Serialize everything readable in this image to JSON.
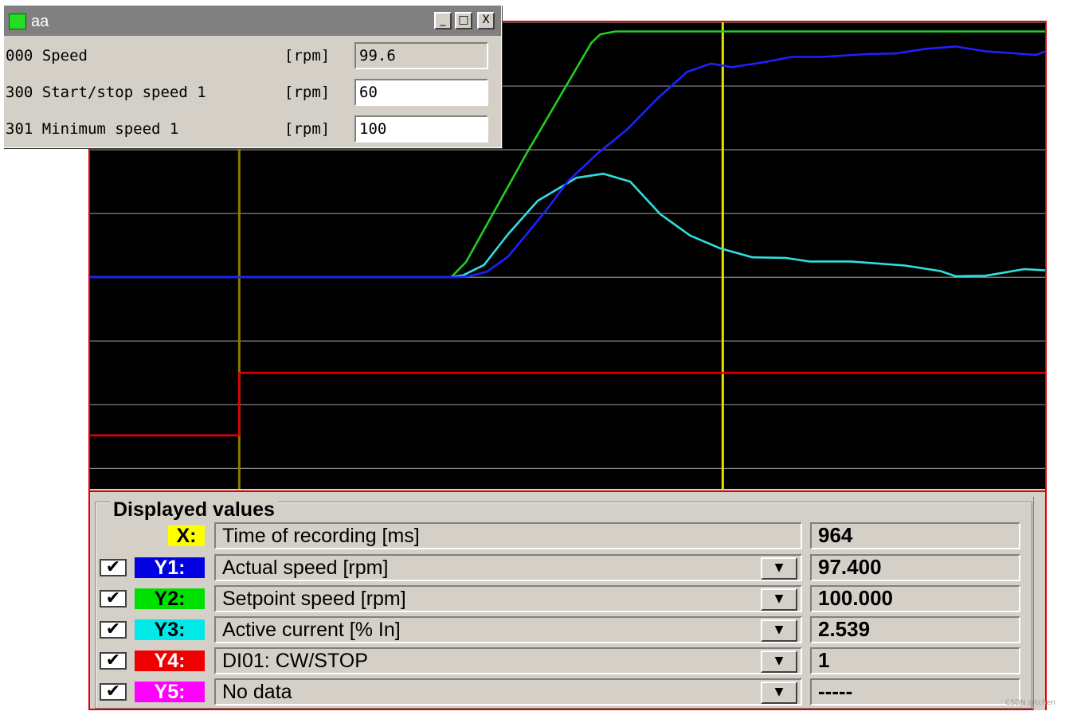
{
  "param_window": {
    "title": "aa",
    "buttons": [
      "_",
      "□",
      "X"
    ],
    "params": [
      {
        "name": "000 Speed",
        "unit": "[rpm]",
        "value": "99.6",
        "editable": false
      },
      {
        "name": "300 Start/stop speed 1",
        "unit": "[rpm]",
        "value": "60",
        "editable": true
      },
      {
        "name": "301 Minimum speed 1",
        "unit": "[rpm]",
        "value": "100",
        "editable": true
      }
    ]
  },
  "chart_data": {
    "type": "line",
    "background": "#000000",
    "grid": true,
    "cursors": [
      {
        "x": 5,
        "color": "#8a7a00"
      },
      {
        "x": 21.2,
        "color": "#e8e000"
      }
    ],
    "series": [
      {
        "name": "Actual speed [rpm]",
        "color": "#2020ff",
        "points": [
          [
            0,
            0
          ],
          [
            12.3,
            0
          ],
          [
            12.7,
            0.4
          ],
          [
            13.3,
            2.2
          ],
          [
            14,
            8
          ],
          [
            14.6,
            16.5
          ],
          [
            15.3,
            26.5
          ],
          [
            16,
            37.5
          ],
          [
            17,
            48.5
          ],
          [
            18,
            58
          ],
          [
            19,
            70
          ],
          [
            20,
            80.5
          ],
          [
            20.8,
            83.8
          ],
          [
            21.5,
            82.4
          ],
          [
            22.6,
            84.4
          ],
          [
            23.5,
            86.4
          ],
          [
            24.5,
            86.4
          ],
          [
            26,
            87.5
          ],
          [
            27,
            87.8
          ],
          [
            28,
            89.6
          ],
          [
            29,
            90.5
          ],
          [
            30,
            88.6
          ],
          [
            31,
            87.8
          ],
          [
            31.7,
            87.2
          ],
          [
            32,
            88.6
          ]
        ]
      },
      {
        "name": "Setpoint speed [rpm]",
        "color": "#20d020",
        "points": [
          [
            0,
            0
          ],
          [
            12.1,
            0
          ],
          [
            12.6,
            6
          ],
          [
            14.6,
            48
          ],
          [
            16.8,
            92
          ],
          [
            17.1,
            95.3
          ],
          [
            17.6,
            96.4
          ],
          [
            32,
            96.4
          ]
        ]
      },
      {
        "name": "Active current [% In]",
        "color": "#30e0e0",
        "points": [
          [
            0,
            0
          ],
          [
            12.1,
            0
          ],
          [
            12.5,
            0.8
          ],
          [
            13.2,
            4.8
          ],
          [
            14,
            16.8
          ],
          [
            15,
            30
          ],
          [
            16.3,
            39
          ],
          [
            17.2,
            40.6
          ],
          [
            18.1,
            37.5
          ],
          [
            19.1,
            24.8
          ],
          [
            20.1,
            16.4
          ],
          [
            21.1,
            11.4
          ],
          [
            22.2,
            7.8
          ],
          [
            23.3,
            7.6
          ],
          [
            24.1,
            6.2
          ],
          [
            25.5,
            6.2
          ],
          [
            27.3,
            4.6
          ],
          [
            28.5,
            2.4
          ],
          [
            29,
            0.4
          ],
          [
            30,
            0.6
          ],
          [
            31.3,
            3.2
          ],
          [
            32,
            2.7
          ]
        ]
      },
      {
        "name": "DI01: CW/STOP",
        "color": "#e00000",
        "points": [
          [
            0,
            -62
          ],
          [
            5,
            -62
          ],
          [
            5,
            -37.5
          ],
          [
            32,
            -37.5
          ]
        ]
      }
    ],
    "xlim": [
      0,
      32
    ],
    "ylim": [
      -83,
      100
    ]
  },
  "values_panel": {
    "title": "Displayed values",
    "rows": [
      {
        "tag": "X:",
        "tag_bg": "#ffff00",
        "tag_fg": "#000000",
        "label": "Time of recording [ms]",
        "value": "964",
        "checkbox": false,
        "dropdown": false
      },
      {
        "tag": "Y1:",
        "tag_bg": "#0000e0",
        "tag_fg": "#ffffff",
        "label": "Actual speed [rpm]",
        "value": "97.400",
        "checkbox": true,
        "dropdown": true
      },
      {
        "tag": "Y2:",
        "tag_bg": "#00e000",
        "tag_fg": "#000000",
        "label": "Setpoint speed [rpm]",
        "value": "100.000",
        "checkbox": true,
        "dropdown": true
      },
      {
        "tag": "Y3:",
        "tag_bg": "#00e8e8",
        "tag_fg": "#000000",
        "label": "Active current [% In]",
        "value": "2.539",
        "checkbox": true,
        "dropdown": true
      },
      {
        "tag": "Y4:",
        "tag_bg": "#ee0000",
        "tag_fg": "#ffffff",
        "label": "DI01: CW/STOP",
        "value": "1",
        "checkbox": true,
        "dropdown": true
      },
      {
        "tag": "Y5:",
        "tag_bg": "#ff00ff",
        "tag_fg": "#ffffff",
        "label": "No data",
        "value": "-----",
        "checkbox": true,
        "dropdown": true
      }
    ],
    "checkmark": "✔",
    "dropdown_glyph": "▼"
  },
  "watermark": "CSDN @tchen"
}
